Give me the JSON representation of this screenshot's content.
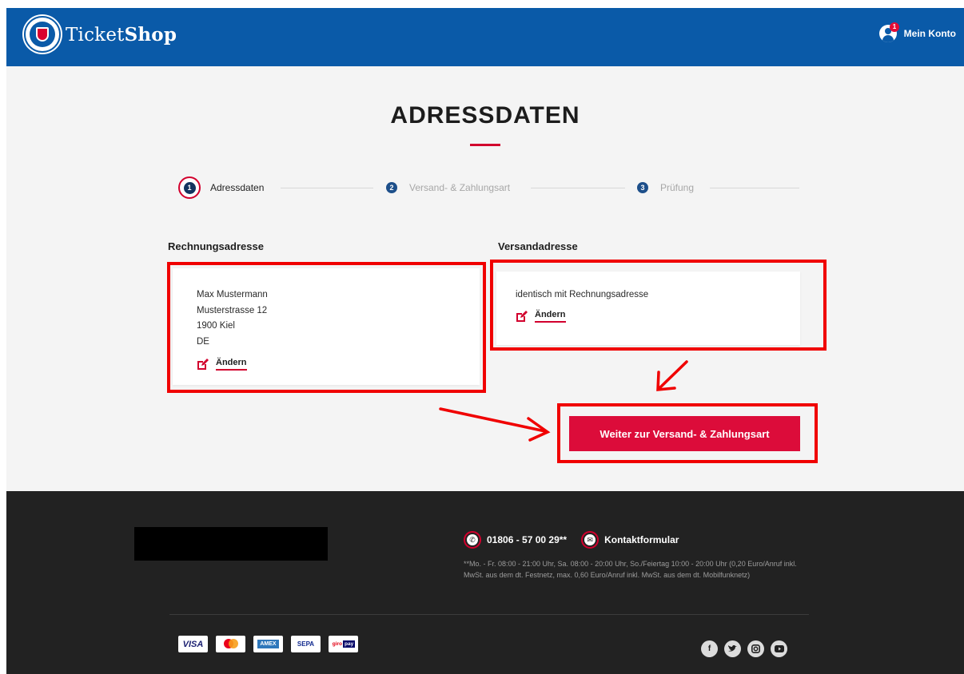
{
  "header": {
    "brand_light": "Ticket",
    "brand_bold": "Shop",
    "account_label": "Mein Konto",
    "account_badge": "1"
  },
  "page": {
    "title": "ADRESSDATEN"
  },
  "steps": [
    {
      "number": "1",
      "label": "Adressdaten",
      "active": true
    },
    {
      "number": "2",
      "label": "Versand- & Zahlungsart",
      "active": false
    },
    {
      "number": "3",
      "label": "Prüfung",
      "active": false
    }
  ],
  "billing": {
    "heading": "Rechnungsadresse",
    "lines": [
      "Max Mustermann",
      "Musterstrasse 12",
      "1900 Kiel",
      "DE"
    ],
    "change_label": "Ändern"
  },
  "shipping": {
    "heading": "Versandadresse",
    "text": "identisch mit Rechnungsadresse",
    "change_label": "Ändern"
  },
  "cta": {
    "label": "Weiter zur Versand- & Zahlungsart"
  },
  "footer": {
    "phone": "01806 - 57 00 29**",
    "contact_form": "Kontaktformular",
    "note": "**Mo. - Fr. 08:00 - 21:00 Uhr, Sa. 08:00 - 20:00 Uhr, So./Feiertag 10:00 - 20:00 Uhr (0,20 Euro/Anruf inkl. MwSt. aus dem dt. Festnetz, max. 0,60 Euro/Anruf inkl. MwSt. aus dem dt. Mobilfunknetz)",
    "payments": [
      "VISA",
      "mastercard",
      "AMEX",
      "SEPA",
      "giropay"
    ],
    "social_icons": [
      "facebook-icon",
      "twitter-icon",
      "instagram-icon",
      "youtube-icon"
    ]
  },
  "colors": {
    "header_blue": "#0a5aa8",
    "accent_red": "#dc0c3a",
    "annotation_red": "#f00000",
    "footer_bg": "#222222"
  }
}
